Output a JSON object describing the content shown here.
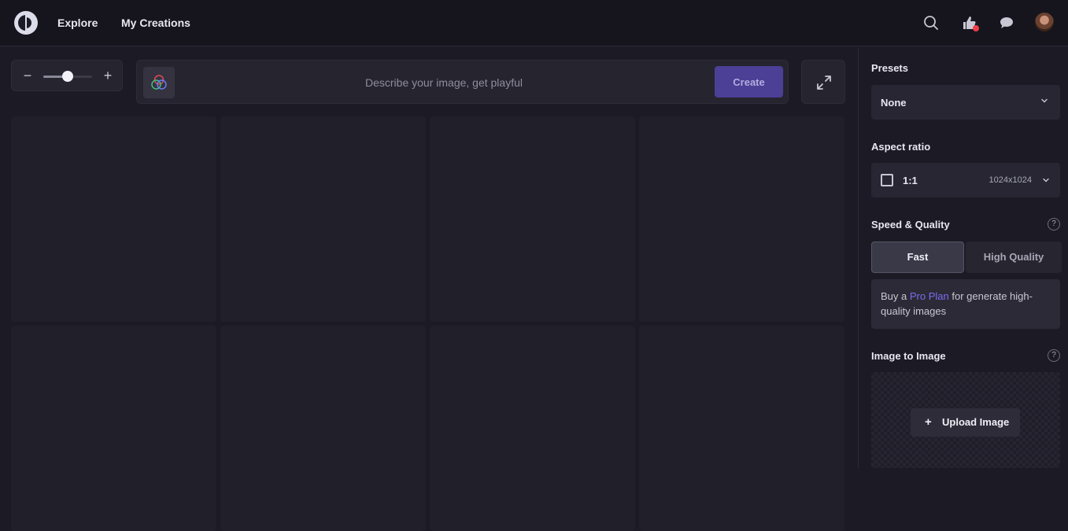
{
  "header": {
    "nav": [
      {
        "label": "Explore"
      },
      {
        "label": "My Creations"
      }
    ],
    "icons": [
      "search-icon",
      "thumbs-up-icon",
      "chat-bubble-icon"
    ],
    "notification_color": "#ef3e4a"
  },
  "toolbar": {
    "zoom_minus": "−",
    "zoom_plus": "+",
    "zoom_level": 0.5,
    "prompt_placeholder": "Describe your image, get playful",
    "prompt_value": "",
    "create_label": "Create",
    "accent": "#4b3f96"
  },
  "sidebar": {
    "presets": {
      "label": "Presets",
      "value": "None"
    },
    "aspect_ratio": {
      "label": "Aspect ratio",
      "value": "1:1",
      "size": "1024x1024"
    },
    "speed_quality": {
      "label": "Speed & Quality",
      "help": "?",
      "options": [
        "Fast",
        "High Quality"
      ],
      "selected": "Fast"
    },
    "pro_notice": {
      "prefix": "Buy a ",
      "link": "Pro Plan",
      "suffix": " for generate high-quality images",
      "link_color": "#7b6cf2"
    },
    "image_to_image": {
      "label": "Image to Image",
      "help": "?",
      "upload_plus": "+",
      "upload_label": "Upload Image"
    }
  }
}
